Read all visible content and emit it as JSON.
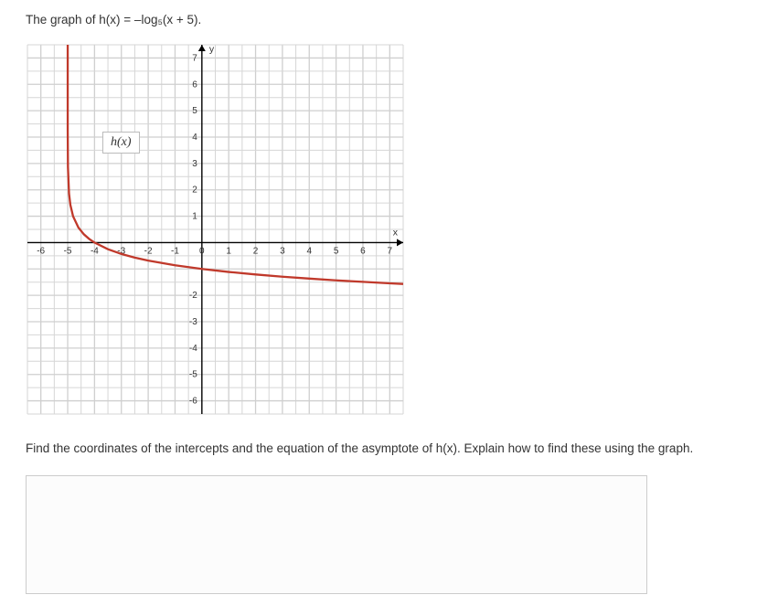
{
  "prompt": "The graph of h(x) = –log₅(x + 5).",
  "function_label": "h(x)",
  "axis_y_label": "y",
  "axis_x_label": "x",
  "question": "Find the coordinates of the intercepts and the equation of the asymptote of h(x). Explain how to find these using the graph.",
  "answer_placeholder": "",
  "chart_data": {
    "type": "line",
    "function": "h(x) = -log_5(x + 5)",
    "title": "",
    "xlabel": "x",
    "ylabel": "y",
    "xlim": [
      -6.5,
      7.5
    ],
    "ylim": [
      -6.5,
      7.5
    ],
    "x_ticks": [
      -6,
      -5,
      -4,
      -3,
      -2,
      -1,
      0,
      1,
      2,
      3,
      4,
      5,
      6,
      7
    ],
    "y_ticks": [
      -6,
      -5,
      -4,
      -3,
      -2,
      1,
      2,
      3,
      4,
      5,
      6,
      7
    ],
    "x": [
      -4.999,
      -4.99,
      -4.95,
      -4.9,
      -4.8,
      -4.6,
      -4.4,
      -4.2,
      -4,
      -3.5,
      -3,
      -2.5,
      -2,
      -1,
      0,
      1,
      2,
      3,
      4,
      5,
      6,
      7,
      7.5
    ],
    "y": [
      4.29,
      2.86,
      1.86,
      1.43,
      1.0,
      0.57,
      0.317,
      0.139,
      0,
      -0.252,
      -0.431,
      -0.569,
      -0.682,
      -0.861,
      -1.0,
      -1.113,
      -1.209,
      -1.292,
      -1.365,
      -1.431,
      -1.489,
      -1.544,
      -1.569
    ],
    "x_intercept": [
      -4,
      0
    ],
    "y_intercept": [
      0,
      -1
    ],
    "asymptote": "x = -5"
  }
}
